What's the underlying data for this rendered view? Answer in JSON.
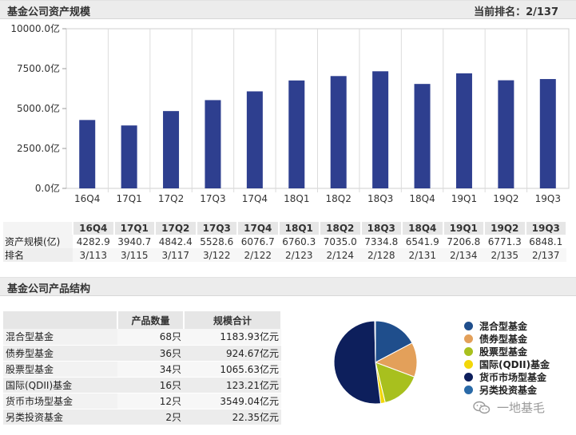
{
  "header": {
    "title": "基金公司资产规模",
    "rank_label": "当前排名：2/137"
  },
  "section2": {
    "title": "基金公司产品结构"
  },
  "colors": {
    "bar": "#2e3f8f",
    "grid": "#dcdcdc"
  },
  "chart_data": {
    "type": "bar",
    "categories": [
      "16Q4",
      "17Q1",
      "17Q2",
      "17Q3",
      "17Q4",
      "18Q1",
      "18Q2",
      "18Q3",
      "18Q4",
      "19Q1",
      "19Q2",
      "19Q3"
    ],
    "values": [
      4282.9,
      3940.7,
      4842.4,
      5528.6,
      6076.7,
      6760.3,
      7035.0,
      7334.8,
      6541.9,
      7206.8,
      6771.3,
      6848.1
    ],
    "yticks": [
      "0.0亿",
      "2500.0亿",
      "5000.0亿",
      "7500.0亿",
      "10000.0亿"
    ],
    "ylim": [
      0,
      10000
    ],
    "grid": "vertical"
  },
  "stats_table": {
    "headers": [
      "16Q4",
      "17Q1",
      "17Q2",
      "17Q3",
      "17Q4",
      "18Q1",
      "18Q2",
      "18Q3",
      "18Q4",
      "19Q1",
      "19Q2",
      "19Q3"
    ],
    "rows": [
      {
        "label": "资产规模(亿)",
        "values": [
          "4282.9",
          "3940.7",
          "4842.4",
          "5528.6",
          "6076.7",
          "6760.3",
          "7035.0",
          "7334.8",
          "6541.9",
          "7206.8",
          "6771.3",
          "6848.1"
        ]
      },
      {
        "label": "排名",
        "values": [
          "3/113",
          "3/115",
          "3/117",
          "3/122",
          "2/122",
          "2/123",
          "2/124",
          "2/128",
          "2/131",
          "2/134",
          "2/135",
          "2/137"
        ]
      }
    ]
  },
  "product_table": {
    "headers": [
      "",
      "产品数量",
      "规模合计"
    ],
    "rows": [
      {
        "name": "混合型基金",
        "count": "68只",
        "total": "1183.93亿元"
      },
      {
        "name": "债券型基金",
        "count": "36只",
        "total": "924.67亿元"
      },
      {
        "name": "股票型基金",
        "count": "34只",
        "total": "1065.63亿元"
      },
      {
        "name": "国际(QDII)基金",
        "count": "16只",
        "total": "123.21亿元"
      },
      {
        "name": "货币市场型基金",
        "count": "12只",
        "total": "3549.04亿元"
      },
      {
        "name": "另类投资基金",
        "count": "2只",
        "total": "22.35亿元"
      }
    ]
  },
  "pie": {
    "type": "pie",
    "slices": [
      {
        "label": "混合型基金",
        "value": 1183.93,
        "color": "#1f4e8c"
      },
      {
        "label": "债券型基金",
        "value": 924.67,
        "color": "#e3a05a"
      },
      {
        "label": "股票型基金",
        "value": 1065.63,
        "color": "#a8c01e"
      },
      {
        "label": "国际(QDII)基金",
        "value": 123.21,
        "color": "#f2d70a"
      },
      {
        "label": "货币市场型基金",
        "value": 3549.04,
        "color": "#0d1f5c"
      },
      {
        "label": "另类投资基金",
        "value": 22.35,
        "color": "#2a6aa8"
      }
    ]
  },
  "legend_items": [
    {
      "label": "混合型基金",
      "color": "#1f4e8c"
    },
    {
      "label": "债券型基金",
      "color": "#e3a05a"
    },
    {
      "label": "股票型基金",
      "color": "#a8c01e"
    },
    {
      "label": "国际(QDII)基金",
      "color": "#f2d70a"
    },
    {
      "label": "货币市场型基金",
      "color": "#0d1f5c"
    },
    {
      "label": "另类投资基金",
      "color": "#2a6aa8"
    }
  ],
  "watermark": {
    "text": "一地基毛",
    "icon": "wechat-icon"
  }
}
